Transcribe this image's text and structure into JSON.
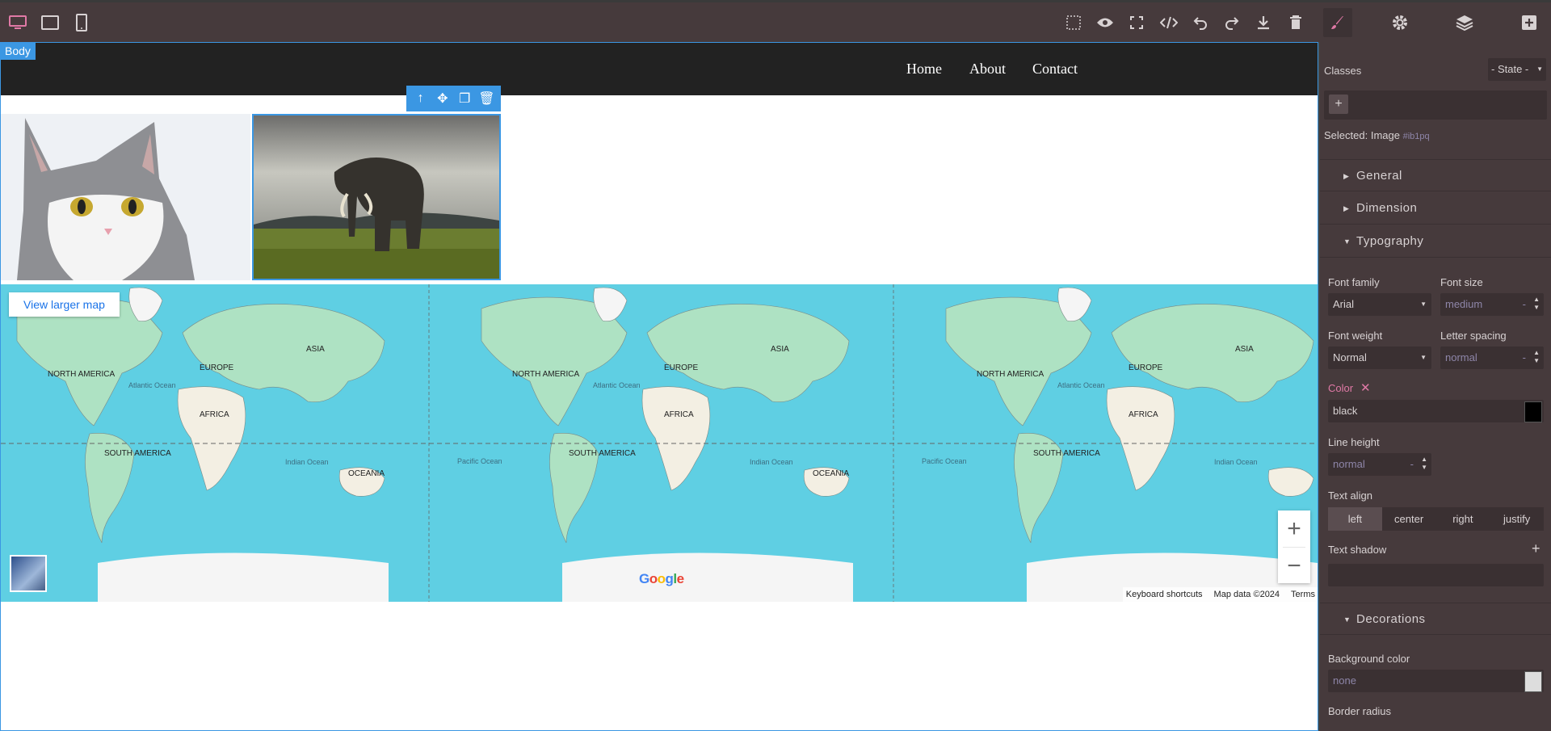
{
  "toolbar": {
    "icons": [
      "desktop-icon",
      "tablet-icon",
      "mobile-icon",
      "select-outline-icon",
      "eye-icon",
      "fullscreen-icon",
      "code-icon",
      "undo-icon",
      "redo-icon",
      "download-icon",
      "trash-icon",
      "brush-icon",
      "gear-icon",
      "layers-icon",
      "add-block-icon"
    ]
  },
  "canvas": {
    "body_badge": "Body",
    "nav": {
      "home": "Home",
      "about": "About",
      "contact": "Contact"
    },
    "map": {
      "view_larger": "View larger map",
      "zoom_in": "+",
      "zoom_out": "−",
      "google": "Google",
      "keyboard_shortcuts": "Keyboard shortcuts",
      "map_data": "Map data ©2024",
      "terms": "Terms",
      "labels": [
        "NORTH AMERICA",
        "EUROPE",
        "ASIA",
        "AFRICA",
        "SOUTH AMERICA",
        "OCEANIA",
        "Atlantic Ocean",
        "Indian Ocean",
        "Pacific Ocean"
      ]
    }
  },
  "panel": {
    "classes_label": "Classes",
    "state": "- State -",
    "add": "+",
    "selected_label": "Selected:",
    "selected_value": "Image",
    "selected_id": "#ib1pq",
    "sections": {
      "general": "General",
      "dimension": "Dimension",
      "typography": "Typography",
      "decorations": "Decorations"
    },
    "font_family_label": "Font family",
    "font_family": "Arial",
    "font_size_label": "Font size",
    "font_size": "medium",
    "font_weight_label": "Font weight",
    "font_weight": "Normal",
    "letter_spacing_label": "Letter spacing",
    "letter_spacing": "normal",
    "unit_dash": "-",
    "color_label": "Color",
    "color_value": "black",
    "line_height_label": "Line height",
    "line_height": "normal",
    "text_align_label": "Text align",
    "align_left": "left",
    "align_center": "center",
    "align_right": "right",
    "align_justify": "justify",
    "text_shadow_label": "Text shadow",
    "bg_color_label": "Background color",
    "bg_color": "none",
    "border_radius_label": "Border radius"
  },
  "colors": {
    "accent": "#3b97e3",
    "panel": "#463a3c",
    "active": "#e079a6",
    "ocean": "#5fcfe3"
  }
}
